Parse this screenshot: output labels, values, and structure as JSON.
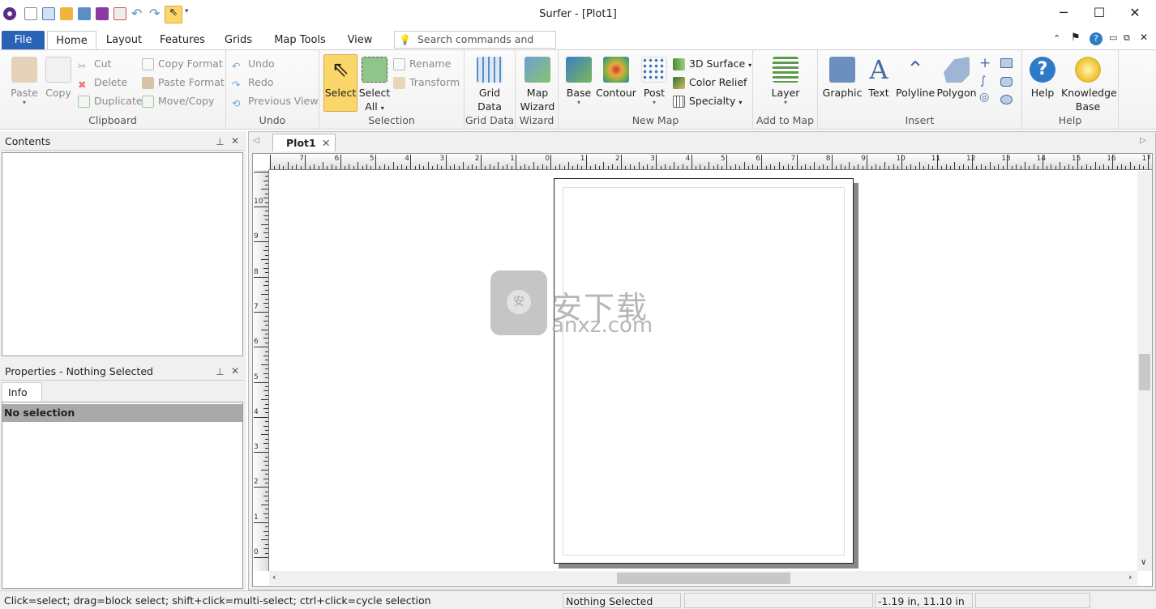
{
  "window": {
    "title": "Surfer - [Plot1]",
    "minimize": "─",
    "maximize": "☐",
    "close": "✕"
  },
  "quick_access": [
    "app-logo",
    "new-plot",
    "new-worksheet",
    "open",
    "reload",
    "save",
    "print-preview",
    "undo",
    "redo",
    "select"
  ],
  "tabs": [
    {
      "label": "File"
    },
    {
      "label": "Home"
    },
    {
      "label": "Layout"
    },
    {
      "label": "Features"
    },
    {
      "label": "Grids"
    },
    {
      "label": "Map Tools"
    },
    {
      "label": "View"
    }
  ],
  "search": {
    "placeholder": "Search commands and Hel..."
  },
  "ribbon": {
    "clipboard": {
      "label": "Clipboard",
      "paste": "Paste",
      "copy": "Copy",
      "cut": "Cut",
      "delete": "Delete",
      "duplicate": "Duplicate",
      "copy_format": "Copy Format",
      "paste_format": "Paste Format",
      "move_copy": "Move/Copy"
    },
    "undo": {
      "label": "Undo",
      "undo": "Undo",
      "redo": "Redo",
      "previous_view": "Previous View"
    },
    "selection": {
      "label": "Selection",
      "select": "Select",
      "select_all_1": "Select",
      "select_all_2": "All",
      "rename": "Rename",
      "transform": "Transform"
    },
    "grid_data": {
      "label": "Grid Data",
      "btn_1": "Grid",
      "btn_2": "Data"
    },
    "wizard": {
      "label": "Wizard",
      "btn_1": "Map",
      "btn_2": "Wizard"
    },
    "new_map": {
      "label": "New Map",
      "base": "Base",
      "contour": "Contour",
      "post": "Post",
      "surface": "3D Surface",
      "color_relief": "Color Relief",
      "specialty": "Specialty"
    },
    "add_to_map": {
      "label": "Add to Map",
      "layer": "Layer"
    },
    "insert": {
      "label": "Insert",
      "graphic": "Graphic",
      "text": "Text",
      "polyline": "Polyline",
      "polygon": "Polygon"
    },
    "help": {
      "label": "Help",
      "help": "Help",
      "kb_1": "Knowledge",
      "kb_2": "Base"
    }
  },
  "contents_panel": {
    "title": "Contents"
  },
  "properties_panel": {
    "title": "Properties - Nothing Selected",
    "tab": "Info",
    "row": "No selection"
  },
  "document": {
    "tab": "Plot1",
    "ruler": {
      "h_min": -8,
      "h_max": 17,
      "v_min": 0,
      "v_max": 11,
      "units": "in"
    }
  },
  "watermark": {
    "text_cn": "安下载",
    "text_en": "anxz.com"
  },
  "status": {
    "hint": "Click=select; drag=block select; shift+click=multi-select; ctrl+click=cycle selection",
    "selection": "Nothing Selected",
    "cursor": "-1.19 in, 11.10 in"
  },
  "colors": {
    "file_tab": "#2a63b6",
    "select_active": "#fbd66a",
    "selection_row": "#a9a9a9"
  }
}
